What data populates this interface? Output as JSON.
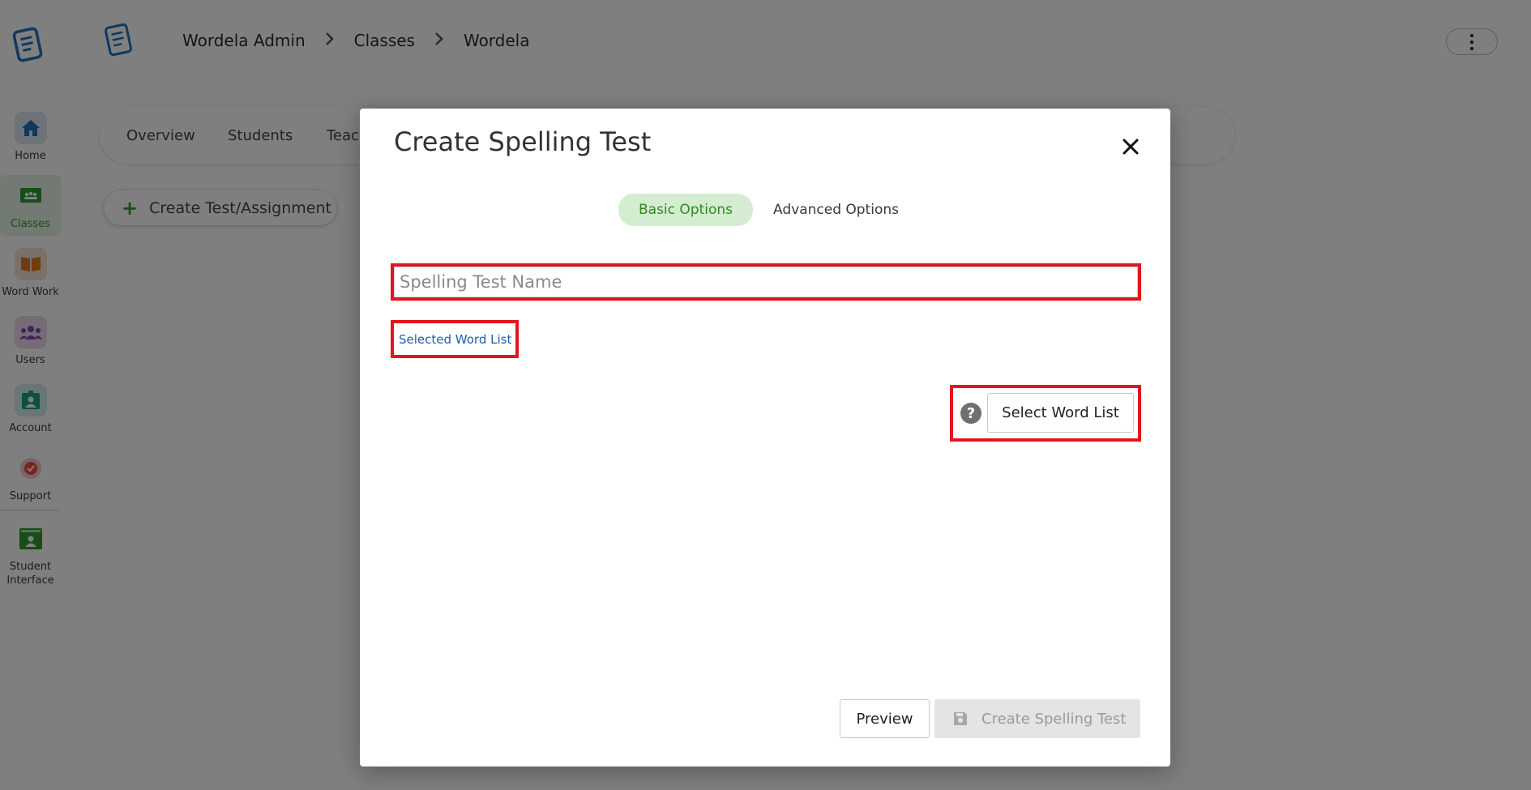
{
  "sidebar": {
    "items": [
      {
        "label": "Home",
        "icon": "home-icon",
        "color": "#1e73be"
      },
      {
        "label": "Classes",
        "icon": "classroom-icon",
        "color": "#2e9a2e",
        "active": true
      },
      {
        "label": "Word Work",
        "icon": "book-icon",
        "color": "#e07b1a"
      },
      {
        "label": "Users",
        "icon": "users-icon",
        "color": "#8e44ad"
      },
      {
        "label": "Account",
        "icon": "account-icon",
        "color": "#16a085"
      },
      {
        "label": "Support",
        "icon": "support-icon",
        "color": "#e74c3c"
      },
      {
        "label_line1": "Student",
        "label_line2": "Interface",
        "icon": "student-interface-icon",
        "color": "#2e9a2e"
      }
    ]
  },
  "header": {
    "breadcrumbs": [
      "Wordela Admin",
      "Classes",
      "Wordela"
    ]
  },
  "class_tabs": [
    "Overview",
    "Students",
    "Teachers"
  ],
  "create_button_label": "Create Test/Assignment",
  "modal": {
    "title": "Create Spelling Test",
    "tabs": [
      {
        "label": "Basic Options",
        "active": true
      },
      {
        "label": "Advanced Options",
        "active": false
      }
    ],
    "name_placeholder": "Spelling Test Name",
    "selected_word_list_label": "Selected Word List",
    "help_glyph": "?",
    "select_word_list_label": "Select Word List",
    "preview_label": "Preview",
    "create_label": "Create Spelling Test"
  },
  "colors": {
    "highlight_border": "#e3151f",
    "active_tab_bg": "#d4edd1",
    "active_tab_text": "#2e8b1f",
    "link": "#1d5fa8"
  }
}
